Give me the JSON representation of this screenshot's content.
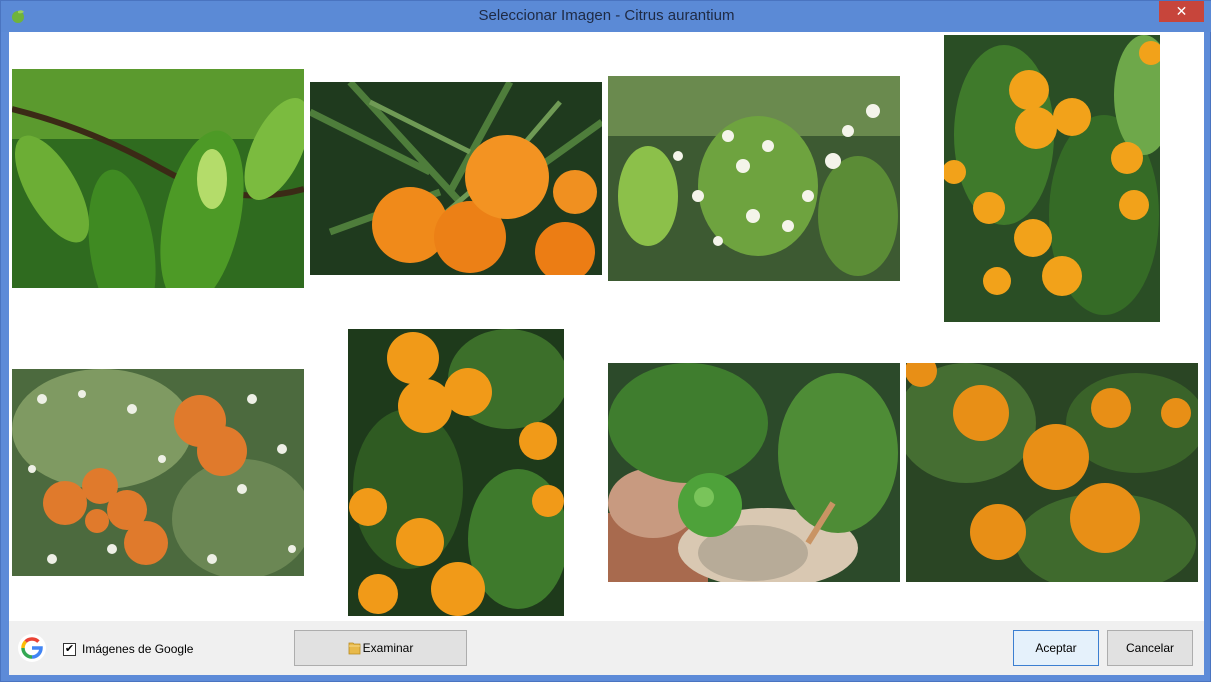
{
  "window": {
    "title": "Seleccionar Imagen - Citrus aurantium",
    "close_glyph": "✕",
    "app_icon": "green-leaf-icon"
  },
  "gallery": {
    "images": [
      {
        "name": "image-leaves",
        "subject": "green leaves"
      },
      {
        "name": "image-oranges-willow-leaves",
        "subject": "oranges with narrow leaves"
      },
      {
        "name": "image-white-blossoms",
        "subject": "white orange blossoms"
      },
      {
        "name": "image-oranges-tree-tall",
        "subject": "oranges on tree"
      },
      {
        "name": "image-oranges-blossoms",
        "subject": "oranges with blossoms"
      },
      {
        "name": "image-oranges-cluster-tall",
        "subject": "orange cluster"
      },
      {
        "name": "image-green-fruit-pot",
        "subject": "green fruit in pot"
      },
      {
        "name": "image-oranges-closeup",
        "subject": "oranges closeup"
      }
    ]
  },
  "footer": {
    "google_checkbox_label": "Imágenes de Google",
    "google_checkbox_checked": true,
    "check_glyph": "✔",
    "browse_label": "Examinar",
    "accept_label": "Aceptar",
    "cancel_label": "Cancelar"
  },
  "colors": {
    "title_bar": "#5b8ad6",
    "close_button": "#c7453b",
    "footer_bg": "#f0f0f0",
    "primary_border": "#3c7fd1"
  }
}
